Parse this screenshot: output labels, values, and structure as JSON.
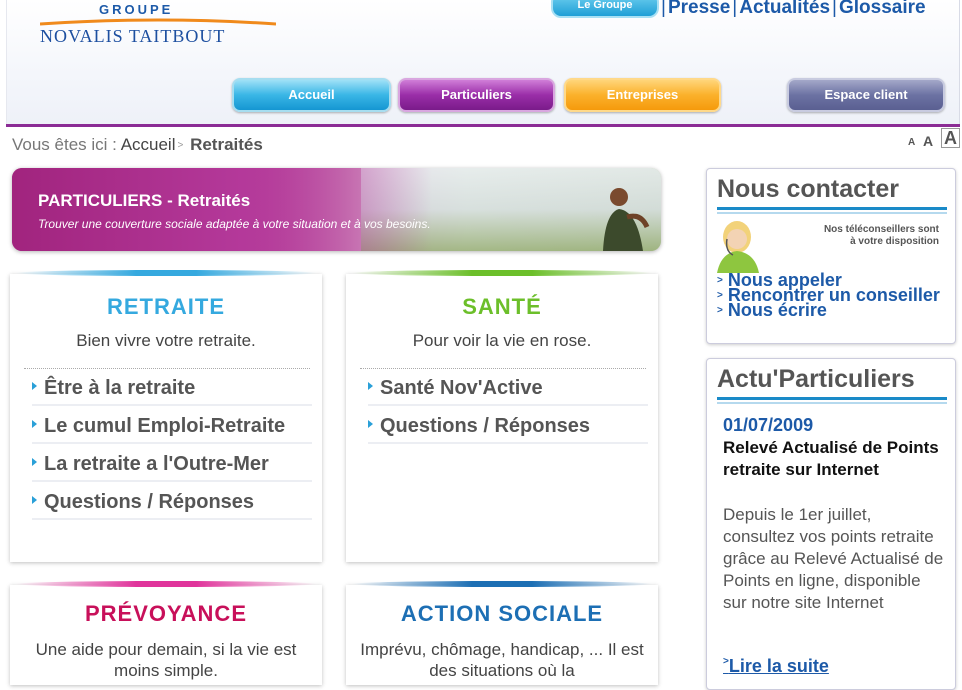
{
  "header": {
    "logo_groupe": "GROUPE",
    "logo_name": "NOVALIS TAITBOUT",
    "legroupe_tab": "Le Groupe",
    "toplinks": [
      "Presse",
      "Actualités",
      "Glossaire"
    ],
    "nav": {
      "accueil": "Accueil",
      "particuliers": "Particuliers",
      "entreprises": "Entreprises",
      "espace_client": "Espace client"
    },
    "font_size_labels": [
      "A",
      "A",
      "A"
    ]
  },
  "breadcrumb": {
    "prefix": "Vous êtes ici :",
    "home": "Accueil",
    "current": "Retraités"
  },
  "banner": {
    "title": "PARTICULIERS - Retraités",
    "subtitle": "Trouver une couverture sociale adaptée à votre situation et à vos besoins."
  },
  "cards": [
    {
      "title": "RETRAITE",
      "subtitle": "Bien vivre votre retraite.",
      "color": "#35a9df",
      "links": [
        "Être à la retraite",
        "Le cumul Emploi-Retraite",
        "La retraite a l'Outre-Mer",
        "Questions / Réponses"
      ]
    },
    {
      "title": "SANTÉ",
      "subtitle": "Pour voir la vie en rose.",
      "color": "#6cbf2a",
      "links": [
        "Santé Nov'Active",
        "Questions / Réponses"
      ]
    },
    {
      "title": "PRÉVOYANCE",
      "subtitle": "Une aide pour demain, si la vie est moins simple.",
      "color": "#c8105a",
      "links": []
    },
    {
      "title": "ACTION SOCIALE",
      "subtitle": "Imprévu, chômage, handicap, ... Il est des situations où la",
      "color": "#1d6fb4",
      "links": []
    }
  ],
  "contact": {
    "title": "Nous contacter",
    "note": "Nos téléconseillers sont à votre disposition",
    "links": [
      "Nous appeler",
      "Rencontrer un conseiller",
      "Nous écrire"
    ]
  },
  "actu": {
    "title": "Actu'Particuliers",
    "date": "01/07/2009",
    "headline": "Relevé Actualisé de Points retraite sur Internet",
    "body": "Depuis le 1er juillet, consultez vos points retraite grâce au Relevé Actualisé de Points en ligne,",
    "body_link": "disponible sur notre site Internet",
    "more": "Lire la suite"
  }
}
